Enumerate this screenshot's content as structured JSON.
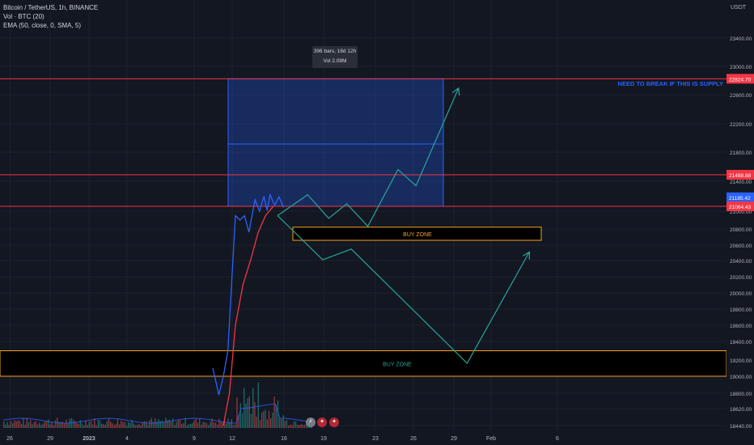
{
  "legend": {
    "symbol": "Bitcoin / TetherUS, 1h, BINANCE",
    "volume": "Vol · BTC (20)",
    "ema": "EMA (50, close, 0, SMA, 5)"
  },
  "measure": {
    "line1": "396 bars, 16d 12h",
    "line2": "Vol 2.08M"
  },
  "annotation_text": "NEED TO BREAK IF THIS IS SUPPLY",
  "colors": {
    "background": "#131722",
    "grid": "#1e222d",
    "price": "#2962ff",
    "ema": "#f23645",
    "resistance": "#f23645",
    "zone": "#f7a21b",
    "projection": "#26a69a",
    "box": "#2962ff"
  },
  "chart_data": {
    "type": "line",
    "title": "Bitcoin / TetherUS, 1h, BINANCE",
    "currency": "USDT",
    "x_tick_labels": [
      "26",
      "29",
      "2023",
      "4",
      "9",
      "12",
      "16",
      "19",
      "23",
      "26",
      "29",
      "Feb",
      "6"
    ],
    "y_tick_labels": [
      "23400.00",
      "23000.00",
      "22600.00",
      "22200.00",
      "21800.00",
      "21400.00",
      "21000.00",
      "20800.00",
      "20600.00",
      "20400.00",
      "20200.00",
      "20000.00",
      "19800.00",
      "19600.00",
      "19400.00",
      "19200.00",
      "19000.00",
      "18800.00",
      "18620.00",
      "18440.00"
    ],
    "y_price_labels": [
      {
        "text": "22824.70",
        "value": 22824.7,
        "color": "#f23645"
      },
      {
        "text": "21488.88",
        "value": 21488.88,
        "color": "#f23645"
      },
      {
        "text": "21185.42",
        "value": 21185.42,
        "color": "#2962ff"
      },
      {
        "text": "21064.43",
        "value": 21064.43,
        "color": "#f23645"
      }
    ],
    "horizontal_levels": [
      22824.7,
      21488.88,
      21064.43
    ],
    "zones": [
      {
        "label": "BUY ZONE",
        "from": 20660,
        "to": 20820
      },
      {
        "label": "BUY ZONE",
        "from": 19000,
        "to": 19300
      }
    ],
    "series": [
      {
        "name": "EMA (50, close, 0, SMA, 5)",
        "color": "#f23645",
        "points": [
          [
            14.2,
            18440
          ],
          [
            14.6,
            18800
          ],
          [
            15.0,
            19600
          ],
          [
            15.5,
            20100
          ],
          [
            16.0,
            20400
          ],
          [
            16.5,
            20750
          ],
          [
            17.0,
            20950
          ],
          [
            17.5,
            21060
          ]
        ]
      },
      {
        "name": "BTCUSDT",
        "color": "#2962ff",
        "points": [
          [
            13.5,
            19100
          ],
          [
            13.9,
            18780
          ],
          [
            14.2,
            19000
          ],
          [
            14.5,
            19300
          ],
          [
            14.8,
            20300
          ],
          [
            15.0,
            20950
          ],
          [
            15.3,
            20900
          ],
          [
            15.6,
            20950
          ],
          [
            15.9,
            20760
          ],
          [
            16.1,
            20950
          ],
          [
            16.3,
            21150
          ],
          [
            16.6,
            21000
          ],
          [
            16.9,
            21200
          ],
          [
            17.1,
            21010
          ],
          [
            17.3,
            21220
          ],
          [
            17.6,
            21080
          ],
          [
            17.9,
            21190
          ],
          [
            18.2,
            21050
          ]
        ]
      }
    ],
    "projections": [
      {
        "points": [
          [
            17.8,
            20950
          ],
          [
            19.8,
            21220
          ],
          [
            21.2,
            20920
          ],
          [
            22.4,
            21100
          ],
          [
            23.8,
            20830
          ],
          [
            25.8,
            21560
          ],
          [
            27.0,
            21340
          ],
          [
            29.8,
            22680
          ]
        ]
      },
      {
        "points": [
          [
            17.8,
            20950
          ],
          [
            20.8,
            20410
          ],
          [
            22.7,
            20550
          ],
          [
            30.4,
            19160
          ],
          [
            34.5,
            20500
          ]
        ]
      }
    ],
    "date_range_box": {
      "x_from": 12,
      "x_to": 28,
      "y_from": 21064.43,
      "y_to": 22824.7
    }
  }
}
